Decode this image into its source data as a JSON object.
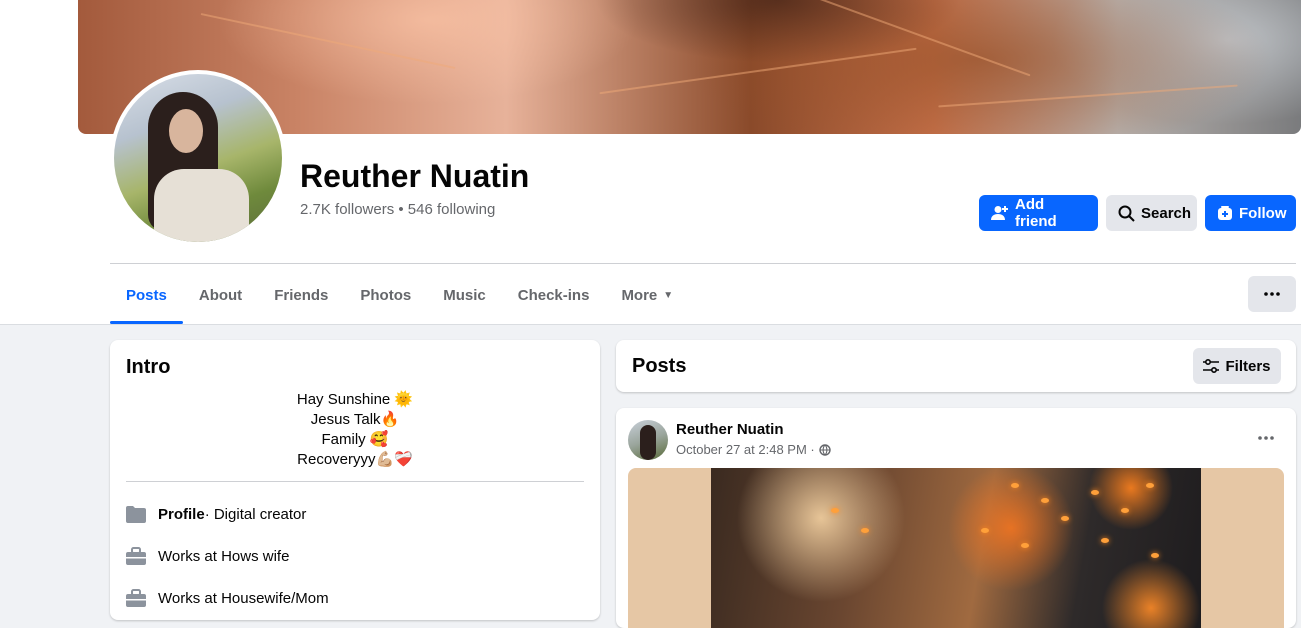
{
  "profile": {
    "name": "Reuther Nuatin",
    "stats": "2.7K followers • 546 following"
  },
  "actions": {
    "add_friend": "Add friend",
    "search": "Search",
    "follow": "Follow"
  },
  "tabs": [
    "Posts",
    "About",
    "Friends",
    "Photos",
    "Music",
    "Check-ins",
    "More"
  ],
  "intro": {
    "title": "Intro",
    "bio": [
      "Hay Sunshine 🌞",
      "Jesus Talk🔥",
      "Family 🥰",
      "Recoveryyy💪🏼❤️‍🩹"
    ],
    "profile_label": "Profile",
    "profile_value": " · Digital creator",
    "works1": "Works at Hows wife",
    "works2": "Works at Housewife/Mom"
  },
  "posts_header": {
    "title": "Posts",
    "filters": "Filters"
  },
  "post": {
    "author": "Reuther Nuatin",
    "date": "October 27 at 2:48 PM ·"
  },
  "colors": {
    "accent": "#0866ff",
    "button_gray": "#e4e6eb",
    "page_bg": "#f0f2f5"
  }
}
